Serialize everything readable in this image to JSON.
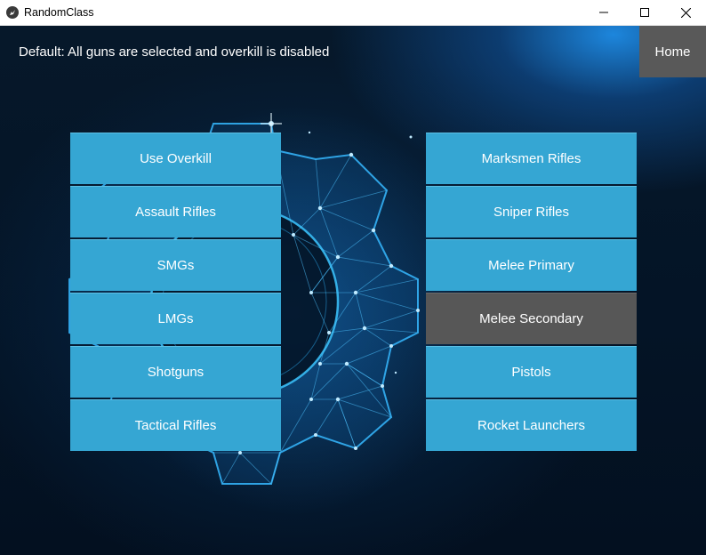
{
  "window": {
    "title": "RandomClass",
    "icons": {
      "app": "kivy-app-icon",
      "minimize": "minimize-icon",
      "maximize": "maximize-icon",
      "close": "close-icon"
    }
  },
  "header": {
    "status": "Default: All guns are selected and overkill is disabled",
    "home_label": "Home"
  },
  "left_buttons": [
    {
      "label": "Use Overkill"
    },
    {
      "label": "Assault Rifles"
    },
    {
      "label": "SMGs"
    },
    {
      "label": "LMGs"
    },
    {
      "label": "Shotguns"
    },
    {
      "label": "Tactical Rifles"
    }
  ],
  "right_buttons": [
    {
      "label": "Marksmen Rifles",
      "selected": false
    },
    {
      "label": "Sniper Rifles",
      "selected": false
    },
    {
      "label": "Melee Primary",
      "selected": false
    },
    {
      "label": "Melee Secondary",
      "selected": true
    },
    {
      "label": "Pistols",
      "selected": false
    },
    {
      "label": "Rocket Launchers",
      "selected": false
    }
  ],
  "colors": {
    "button": "#35a6d3",
    "button_selected": "#575757",
    "home": "#595959",
    "background": "#041426",
    "accent_glow": "#1e8ce6"
  }
}
